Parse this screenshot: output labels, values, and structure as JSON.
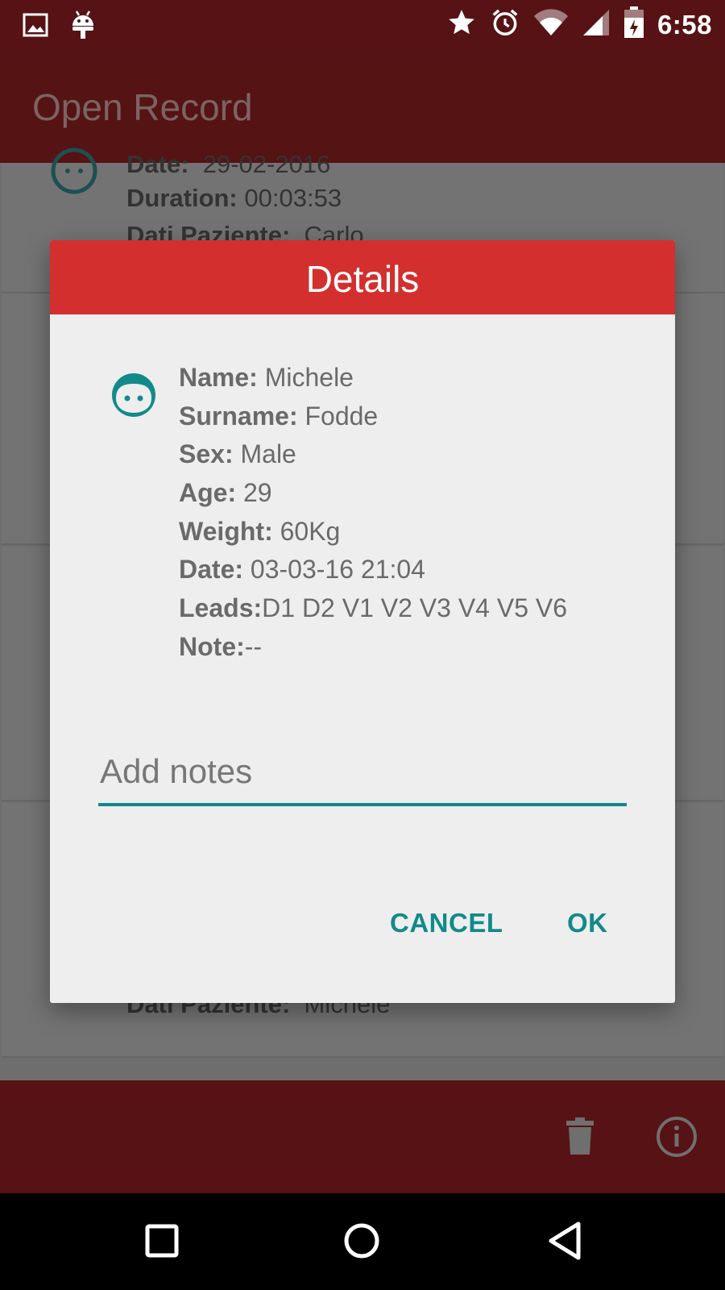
{
  "status_bar": {
    "time": "6:58",
    "icons": [
      "image-icon",
      "android-icon",
      "star-icon",
      "alarm-icon",
      "wifi-icon",
      "signal-icon",
      "battery-icon"
    ]
  },
  "app_bar": {
    "title": "Open Record"
  },
  "background_list": {
    "card1": {
      "date_label": "Date:",
      "date_value": "29-02-2016",
      "duration_label": "Duration:",
      "duration_value": "00:03:53",
      "patient_label": "Dati Paziente:",
      "patient_value": "Carlo"
    },
    "card_last": {
      "patient_label": "Dati Paziente:",
      "patient_value": "Michele"
    }
  },
  "dialog": {
    "title": "Details",
    "details": [
      {
        "label": "Name:",
        "value": " Michele"
      },
      {
        "label": "Surname:",
        "value": " Fodde"
      },
      {
        "label": "Sex:",
        "value": " Male"
      },
      {
        "label": "Age:",
        "value": " 29"
      },
      {
        "label": "Weight:",
        "value": " 60Kg"
      },
      {
        "label": "Date:",
        "value": " 03-03-16 21:04"
      },
      {
        "label": "Leads:",
        "value": "D1 D2 V1 V2 V3 V4 V5 V6"
      },
      {
        "label": "Note:",
        "value": "--"
      }
    ],
    "notes": {
      "placeholder": "Add notes",
      "value": ""
    },
    "cancel_label": "CANCEL",
    "ok_label": "OK"
  },
  "colors": {
    "status_bar": "#561214",
    "app_bar": "#551314",
    "dialog_header": "#d32f2f",
    "accent": "#138a8a"
  }
}
